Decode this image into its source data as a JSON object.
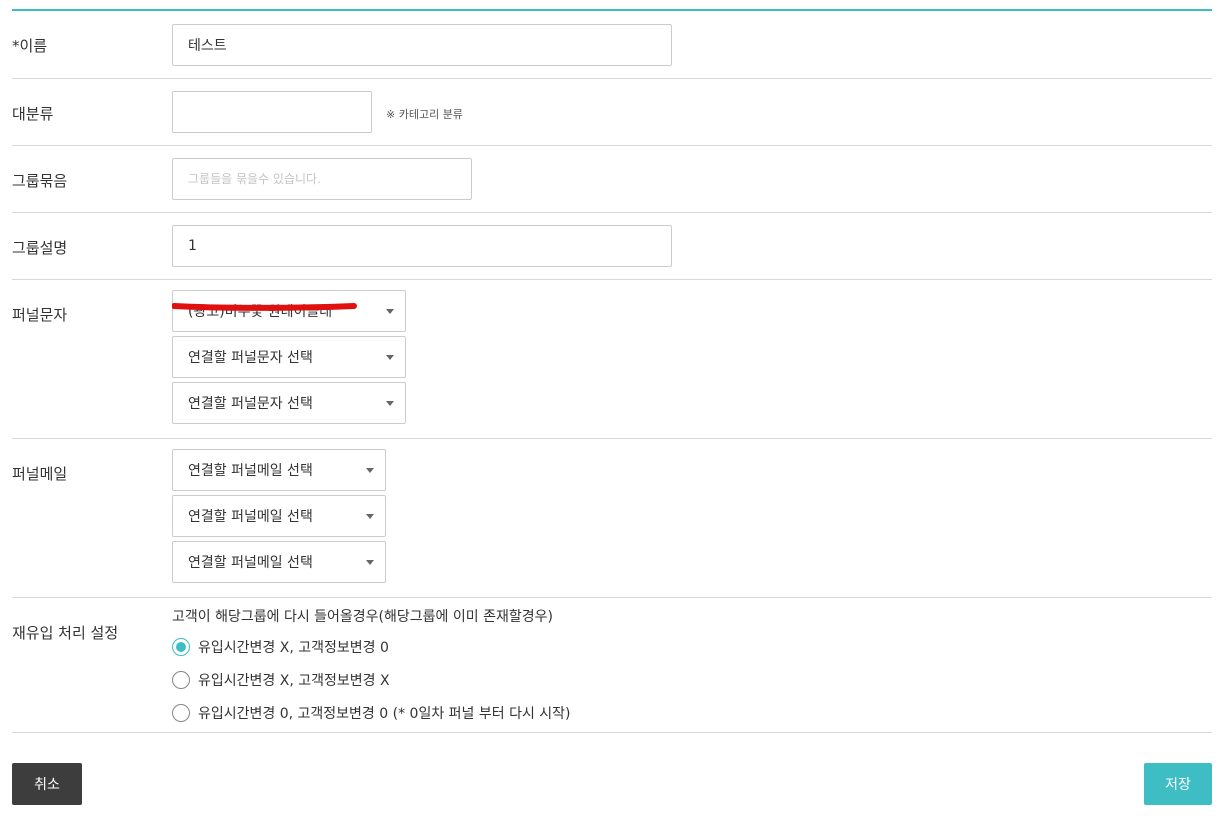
{
  "accent_color": "#3ebdc4",
  "form": {
    "name": {
      "label": "*이름",
      "value": "테스트"
    },
    "category": {
      "label": "대분류",
      "value": "",
      "hint": "※ 카테고리 분류"
    },
    "group_bundle": {
      "label": "그룹묶음",
      "value": "",
      "placeholder": "그룹들을 묶을수 있습니다."
    },
    "group_desc": {
      "label": "그룹설명",
      "value": "1"
    },
    "funnel_sms": {
      "label": "퍼널문자",
      "selects": [
        "(광고)비누꽃 원데이클래",
        "연결할 퍼널문자 선택",
        "연결할 퍼널문자 선택"
      ]
    },
    "funnel_mail": {
      "label": "퍼널메일",
      "selects": [
        "연결할 퍼널메일 선택",
        "연결할 퍼널메일 선택",
        "연결할 퍼널메일 선택"
      ]
    },
    "reentry": {
      "label": "재유입 처리 설정",
      "description": "고객이 해당그룹에 다시 들어올경우(해당그룹에 이미 존재할경우)",
      "options": [
        {
          "label": "유입시간변경 X, 고객정보변경 0",
          "checked": true
        },
        {
          "label": "유입시간변경 X, 고객정보변경 X",
          "checked": false
        },
        {
          "label": "유입시간변경 0, 고객정보변경 0 (* 0일차 퍼널 부터 다시 시작)",
          "checked": false
        }
      ]
    }
  },
  "buttons": {
    "cancel": "취소",
    "save": "저장"
  }
}
